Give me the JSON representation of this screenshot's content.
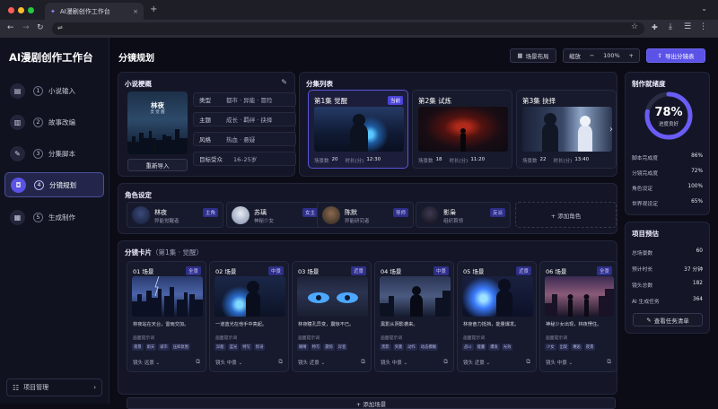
{
  "browser": {
    "tab_title": "AI漫剧创作工作台",
    "close": "×",
    "new_tab": "+"
  },
  "sidebar": {
    "logo": "AI漫剧创作工作台",
    "items": [
      {
        "num": "1",
        "label": "小说输入",
        "icon": "book-open-icon"
      },
      {
        "num": "2",
        "label": "故事改编",
        "icon": "book-icon"
      },
      {
        "num": "3",
        "label": "分集脚本",
        "icon": "pen-icon"
      },
      {
        "num": "4",
        "label": "分镜规划",
        "icon": "camera-icon"
      },
      {
        "num": "5",
        "label": "生成制作",
        "icon": "clapper-icon"
      }
    ],
    "project_label": "项目管理"
  },
  "header": {
    "title": "分镜规划",
    "layout_btn": "场景布局",
    "zoom_label": "缩放",
    "zoom_minus": "−",
    "zoom_value": "100%",
    "zoom_plus": "+",
    "export_btn": "导出分镜表"
  },
  "synopsis": {
    "title": "小说梗概",
    "cover_title": "林夜",
    "cover_subtitle": "灵 觉 醒",
    "reimport": "重新导入",
    "fields": [
      {
        "k": "类型",
        "v": "都市 · 异能 · 冒险"
      },
      {
        "k": "主题",
        "v": "成长 · 羁绊 · 抉择"
      },
      {
        "k": "风格",
        "v": "热血 · 悬疑"
      },
      {
        "k": "目标受众",
        "v": "16–25岁"
      }
    ]
  },
  "episodes": {
    "title": "分集列表",
    "items": [
      {
        "title": "第1集  觉醒",
        "badge": "当前",
        "scenes_label": "场景数",
        "scenes": "20",
        "dur_label": "时长(分)",
        "dur": "12:30"
      },
      {
        "title": "第2集  试炼",
        "badge": "",
        "scenes_label": "场景数",
        "scenes": "18",
        "dur_label": "时长(分)",
        "dur": "11:20"
      },
      {
        "title": "第3集  抉择",
        "badge": "",
        "scenes_label": "场景数",
        "scenes": "22",
        "dur_label": "时长(分)",
        "dur": "13:40"
      }
    ],
    "next": "›"
  },
  "characters": {
    "title": "角色设定",
    "items": [
      {
        "name": "林夜",
        "role": "异能觉醒者",
        "badge": "主角"
      },
      {
        "name": "苏璃",
        "role": "神秘少女",
        "badge": "女主"
      },
      {
        "name": "陈默",
        "role": "异能研究者",
        "badge": "导师"
      },
      {
        "name": "影枭",
        "role": "组织首领",
        "badge": "反派"
      }
    ],
    "add": "+ 添加角色"
  },
  "cards": {
    "title": "分镜卡片",
    "subtitle": "（第1集 · 觉醒）",
    "prompt_label": "画面提示词",
    "add_scene": "+ 添加场景",
    "items": [
      {
        "label": "01 场景",
        "badge": "全景",
        "desc": "林夜站在天台，雷雨交加。",
        "tags": [
          "夜景",
          "雨天",
          "城市",
          "压抑氛围"
        ],
        "shot": "镜头  远景 ⌄"
      },
      {
        "label": "02 场景",
        "badge": "中景",
        "desc": "一道蓝光在他手中亮起。",
        "tags": [
          "异能",
          "蓝光",
          "特写",
          "惊讶"
        ],
        "shot": "镜头  中景 ⌄"
      },
      {
        "label": "03 场景",
        "badge": "近景",
        "desc": "林夜瞳孔异变，震惊不已。",
        "tags": [
          "眼睛",
          "特写",
          "震惊",
          "异变"
        ],
        "shot": "镜头  近景 ⌄"
      },
      {
        "label": "04 场景",
        "badge": "中景",
        "desc": "黑影从阴影袭来。",
        "tags": [
          "黑影",
          "突袭",
          "动作",
          "动态模糊"
        ],
        "shot": "镜头  中景 ⌄"
      },
      {
        "label": "05 场景",
        "badge": "近景",
        "desc": "林夜奋力抵挡，能量爆发。",
        "tags": [
          "战斗",
          "能量",
          "爆发",
          "光效"
        ],
        "shot": "镜头  近景 ⌄"
      },
      {
        "label": "06 场景",
        "badge": "全景",
        "desc": "神秘少女出现，林夜愣住。",
        "tags": [
          "少女",
          "出现",
          "邂逅",
          "夜景"
        ],
        "shot": "镜头  中景 ⌄"
      }
    ]
  },
  "progress": {
    "title": "制作就绪度",
    "percent": 78,
    "percent_text": "78%",
    "label": "进度良好",
    "rows": [
      {
        "k": "脚本完成度",
        "v": "86%"
      },
      {
        "k": "分镜完成度",
        "v": "72%"
      },
      {
        "k": "角色设定",
        "v": "100%"
      },
      {
        "k": "世界观设定",
        "v": "65%"
      }
    ]
  },
  "estimate": {
    "title": "项目预估",
    "rows": [
      {
        "k": "总场景数",
        "v": "60"
      },
      {
        "k": "预计时长",
        "v": "37 分钟"
      },
      {
        "k": "镜头总数",
        "v": "182"
      },
      {
        "k": "AI 生成任务",
        "v": "364"
      }
    ],
    "button": "查看任务清单"
  },
  "colors": {
    "accent": "#5b52e6",
    "bg": "#0b0c16",
    "panel": "#141627"
  }
}
